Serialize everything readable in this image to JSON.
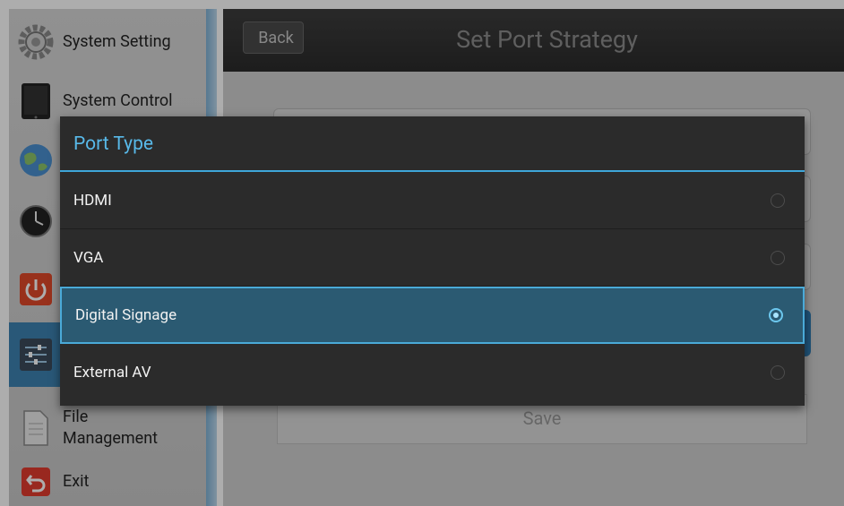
{
  "sidebar": {
    "items": [
      {
        "label": "System Setting",
        "icon": "gear-icon"
      },
      {
        "label": "System Control",
        "icon": "tablet-icon"
      },
      {
        "label": "",
        "icon": "globe-icon"
      },
      {
        "label": "",
        "icon": "clock-icon"
      },
      {
        "label": "",
        "icon": "power-icon"
      },
      {
        "label": "",
        "icon": "sliders-icon"
      },
      {
        "label": "File Management",
        "icon": "file-icon"
      },
      {
        "label": "Exit",
        "icon": "exit-icon"
      }
    ]
  },
  "header": {
    "back_label": "Back",
    "title": "Set Port Strategy"
  },
  "background": {
    "save_label": "Save"
  },
  "dialog": {
    "title": "Port Type",
    "options": [
      {
        "label": "HDMI",
        "selected": false
      },
      {
        "label": "VGA",
        "selected": false
      },
      {
        "label": "Digital Signage",
        "selected": true
      },
      {
        "label": "External AV",
        "selected": false
      }
    ]
  },
  "colors": {
    "accent": "#58b9e9",
    "selected_bg": "#2b5a72",
    "sidebar_active": "#3d82b2"
  }
}
